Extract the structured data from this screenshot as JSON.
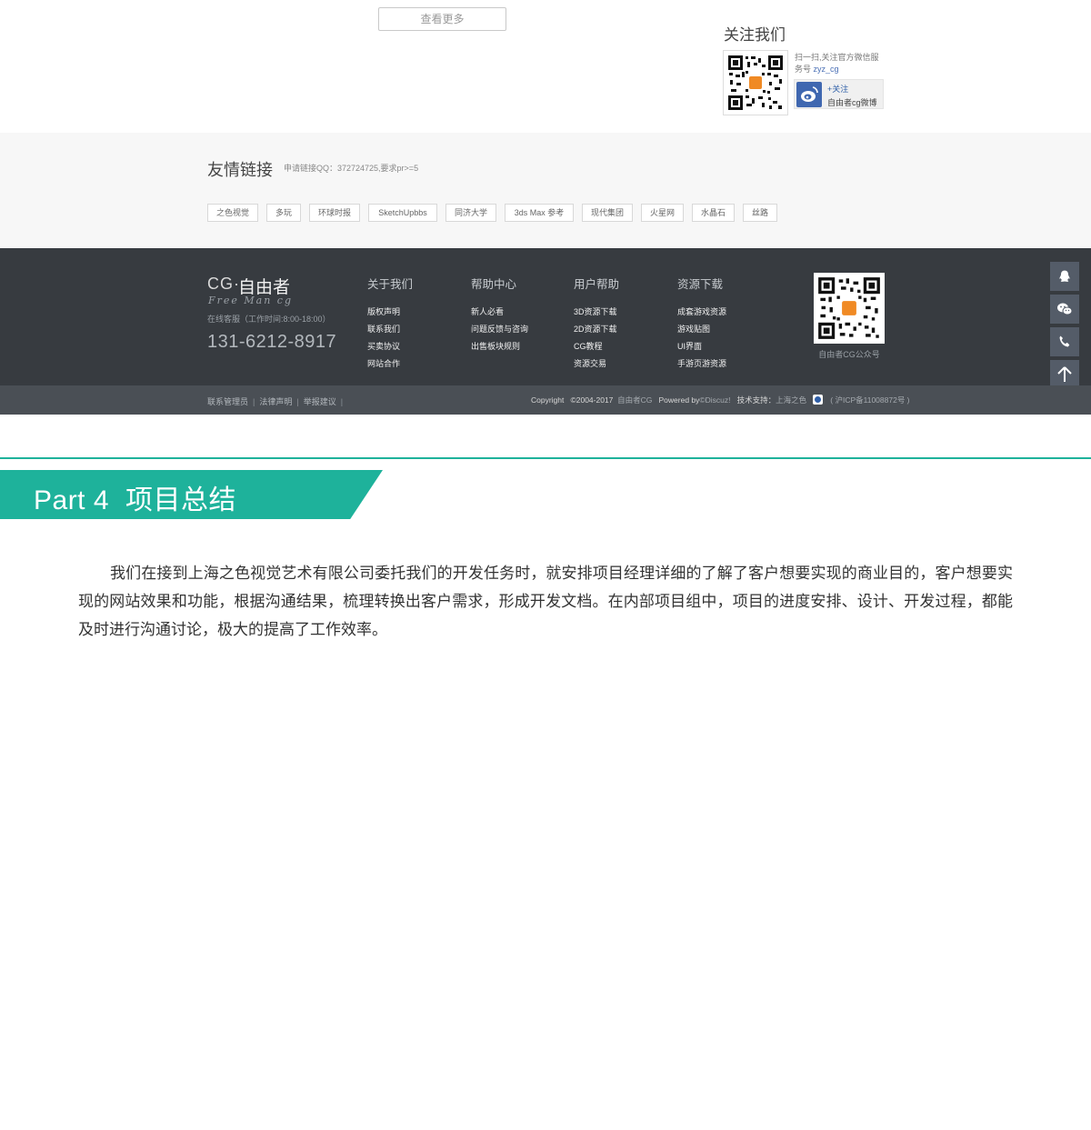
{
  "top": {
    "more_button": "查看更多",
    "follow_title": "关注我们",
    "follow_desc": "扫一扫,关注官方微信服务号",
    "follow_account": "zyz_cg",
    "weibo_follow": "+关注",
    "weibo_name": "自由者cg微博"
  },
  "links": {
    "title": "友情链接",
    "note": "申请链接QQ：372724725,要求pr>=5",
    "items": [
      "之色视觉",
      "多玩",
      "环球时报",
      "SketchUpbbs",
      "同济大学",
      "3ds Max 参考",
      "现代集团",
      "火星网",
      "水晶石",
      "丝路"
    ]
  },
  "footer": {
    "brand_cg": "CG·",
    "brand_cn": "自由者",
    "brand_sub": "Free Man cg",
    "service_time": "在线客服（工作时间:8:00-18:00）",
    "phone": "131-6212-8917",
    "columns": [
      {
        "title": "关于我们",
        "items": [
          "版权声明",
          "联系我们",
          "买卖协议",
          "网站合作"
        ]
      },
      {
        "title": "帮助中心",
        "items": [
          "新人必看",
          "问题反馈与咨询",
          "出售板块规则"
        ]
      },
      {
        "title": "用户帮助",
        "items": [
          "3D资源下载",
          "2D资源下载",
          "CG教程",
          "资源交易"
        ]
      },
      {
        "title": "资源下载",
        "items": [
          "成套游戏资源",
          "游戏贴图",
          "UI界面",
          "手游页游资源"
        ]
      }
    ],
    "qr_label": "自由者CG公众号",
    "bar_left": [
      "联系管理员",
      "法律声明",
      "举报建议"
    ],
    "bar_copyright": "Copyright",
    "bar_years": "©2004-2017",
    "bar_site": "自由者CG",
    "bar_powered": "Powered by",
    "bar_discuz": "©Discuz!",
    "bar_support_label": "技术支持：",
    "bar_support": "上海之色",
    "bar_icp": "( 沪ICP备11008872号 )"
  },
  "side_buttons": [
    "qq-icon",
    "wechat-icon",
    "phone-icon",
    "back-to-top-icon"
  ],
  "section": {
    "part": "Part 4",
    "title": "项目总结",
    "paragraph": "我们在接到上海之色视觉艺术有限公司委托我们的开发任务时，就安排项目经理详细的了解了客户想要实现的商业目的，客户想要实现的网站效果和功能，根据沟通结果，梳理转换出客户需求，形成开发文档。在内部项目组中，项目的进度安排、设计、开发过程，都能及时进行沟通讨论，极大的提高了工作效率。"
  },
  "colors": {
    "accent": "#1eb29b",
    "footer_bg": "#373b40",
    "footer_bar": "#4a4f55",
    "links_bg": "#f7f7f7",
    "side_button": "#545c68"
  }
}
